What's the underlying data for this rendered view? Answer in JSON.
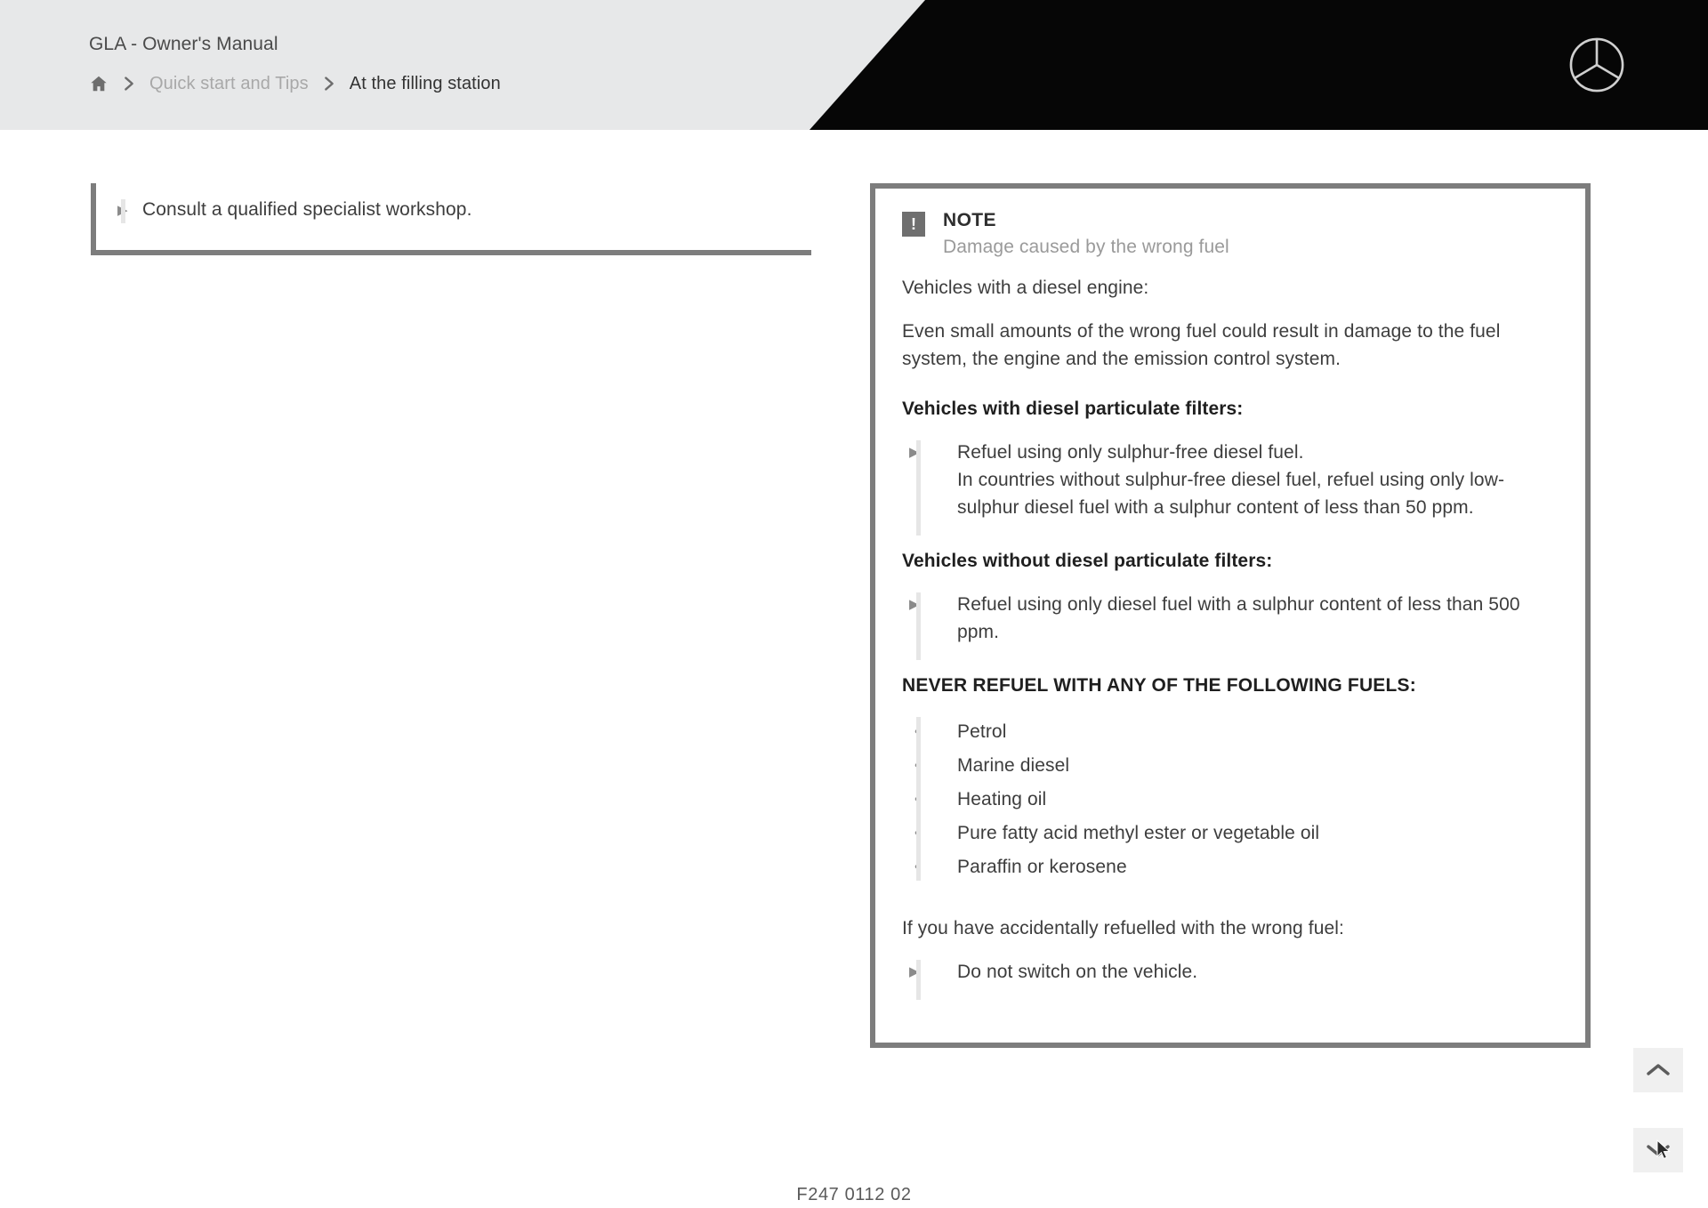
{
  "header": {
    "title": "GLA - Owner's Manual",
    "breadcrumb": {
      "home_icon": "home-icon",
      "separator": "›",
      "items": [
        {
          "label": "Quick start and Tips",
          "current": false
        },
        {
          "label": "At the filling station",
          "current": true
        }
      ]
    },
    "logo": "mercedes-benz-star-logo",
    "colors": {
      "bar_background": "#e7e8e9",
      "panel_black": "#060606"
    }
  },
  "left_column": {
    "continued_note": {
      "bullet_marker": "▶",
      "text": "Consult a qualified specialist workshop."
    }
  },
  "right_column": {
    "note": {
      "icon": "exclamation-mark-icon",
      "icon_glyph": "!",
      "label": "NOTE",
      "subtitle": "Damage caused by the wrong fuel",
      "intro": "Vehicles with a diesel engine:",
      "paragraph": "Even small amounts of the wrong fuel could result in damage to the fuel system, the engine and the emission control system.",
      "section_with_filters": {
        "heading": "Vehicles with diesel particulate filters:",
        "bullet_marker": "▶",
        "bullet": "Refuel using only sulphur-free diesel fuel.",
        "bullet_detail": "In countries without sulphur-free diesel fuel, refuel using only low-sulphur diesel fuel with a sulphur content of less than 50 ppm."
      },
      "section_without_filters": {
        "heading": "Vehicles without diesel particulate filters:",
        "bullet_marker": "▶",
        "bullet": "Refuel using only diesel fuel with a sulphur content of less than 500 ppm."
      },
      "never_refuel": {
        "heading": "NEVER REFUEL WITH ANY OF THE FOLLOWING FUELS:",
        "dot_marker": "•",
        "items": [
          "Petrol",
          "Marine diesel",
          "Heating oil",
          "Pure fatty acid methyl ester or vegetable oil",
          "Paraffin or kerosene"
        ]
      },
      "accidental": {
        "intro": "If you have accidentally refuelled with the wrong fuel:",
        "bullet_marker": "▶",
        "bullet": "Do not switch on the vehicle."
      },
      "colors": {
        "border": "#7d7d7d",
        "icon_background": "#6f6f6f"
      }
    }
  },
  "footer": {
    "code": "F247 0112 02"
  },
  "side_controls": {
    "scroll_up": {
      "icon": "chevron-up-icon",
      "label": "Scroll up"
    },
    "scroll_down": {
      "icon": "chevron-down-icon",
      "label": "Scroll down"
    }
  }
}
